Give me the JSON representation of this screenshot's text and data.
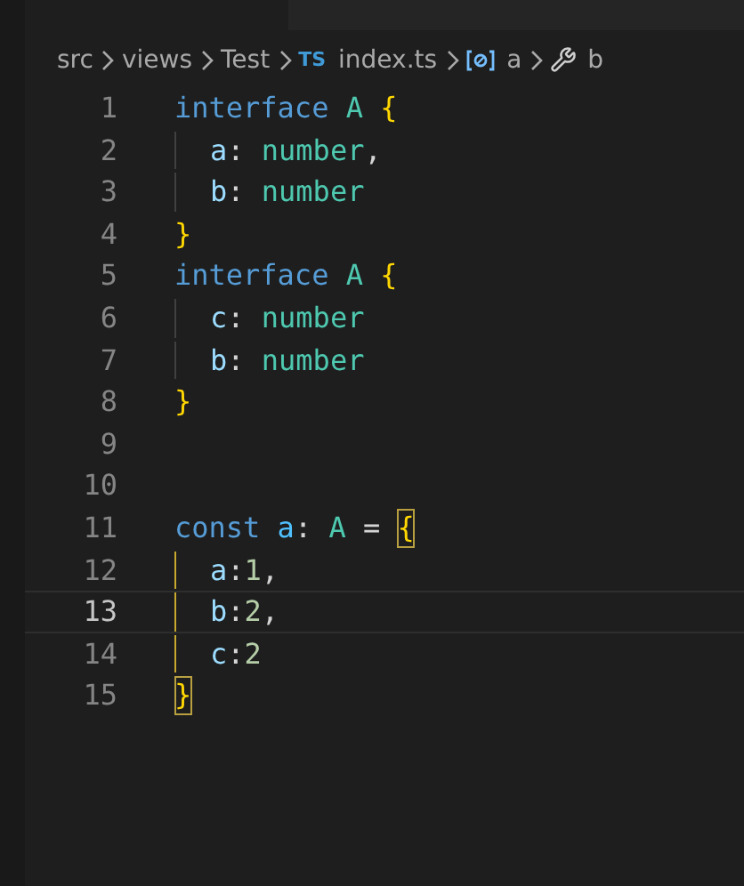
{
  "tab": {
    "selected": true
  },
  "breadcrumbs": [
    {
      "kind": "folder",
      "label": "src"
    },
    {
      "kind": "folder",
      "label": "views"
    },
    {
      "kind": "folder",
      "label": "Test"
    },
    {
      "kind": "file",
      "badge": "TS",
      "label": "index.ts"
    },
    {
      "kind": "variable",
      "label": "a"
    },
    {
      "kind": "property",
      "label": "b"
    }
  ],
  "lines": [
    {
      "number": "1",
      "selected": false,
      "kind": "plain",
      "tokens": [
        {
          "kind": "keyword",
          "text": "interface "
        },
        {
          "kind": "type",
          "text": "A "
        },
        {
          "kind": "bracket",
          "text": "{"
        }
      ]
    },
    {
      "number": "2",
      "selected": false,
      "kind": "nested",
      "tokens": [
        {
          "kind": "property",
          "text": "a"
        },
        {
          "kind": "punct",
          "text": ": "
        },
        {
          "kind": "type",
          "text": "number"
        },
        {
          "kind": "punct",
          "text": ","
        }
      ]
    },
    {
      "number": "3",
      "selected": false,
      "kind": "nested",
      "tokens": [
        {
          "kind": "property",
          "text": "b"
        },
        {
          "kind": "punct",
          "text": ": "
        },
        {
          "kind": "type",
          "text": "number"
        }
      ]
    },
    {
      "number": "4",
      "selected": false,
      "kind": "plain",
      "tokens": [
        {
          "kind": "bracket",
          "text": "}"
        }
      ]
    },
    {
      "number": "5",
      "selected": false,
      "kind": "plain",
      "tokens": [
        {
          "kind": "keyword",
          "text": "interface "
        },
        {
          "kind": "type",
          "text": "A "
        },
        {
          "kind": "bracket",
          "text": "{"
        }
      ]
    },
    {
      "number": "6",
      "selected": false,
      "kind": "nested",
      "tokens": [
        {
          "kind": "property",
          "text": "c"
        },
        {
          "kind": "punct",
          "text": ": "
        },
        {
          "kind": "type",
          "text": "number"
        }
      ]
    },
    {
      "number": "7",
      "selected": false,
      "kind": "nested",
      "tokens": [
        {
          "kind": "property",
          "text": "b"
        },
        {
          "kind": "punct",
          "text": ": "
        },
        {
          "kind": "type",
          "text": "number"
        }
      ]
    },
    {
      "number": "8",
      "selected": false,
      "kind": "plain",
      "tokens": [
        {
          "kind": "bracket",
          "text": "}"
        }
      ]
    },
    {
      "number": "9",
      "selected": false,
      "kind": "plain"
    },
    {
      "number": "10",
      "selected": false,
      "kind": "plain"
    },
    {
      "number": "11",
      "selected": false,
      "kind": "plain",
      "tokens": [
        {
          "kind": "keyword",
          "text": "const "
        },
        {
          "kind": "variable",
          "text": "a"
        },
        {
          "kind": "punct",
          "text": ": "
        },
        {
          "kind": "type",
          "text": "A "
        },
        {
          "kind": "punct",
          "text": "= "
        },
        {
          "kind": "bracket_match",
          "text": "{"
        }
      ]
    },
    {
      "number": "12",
      "selected": false,
      "kind": "bracketed",
      "tokens": [
        {
          "kind": "property",
          "text": "a"
        },
        {
          "kind": "punct",
          "text": ":"
        },
        {
          "kind": "number",
          "text": "1"
        },
        {
          "kind": "punct",
          "text": ","
        }
      ]
    },
    {
      "number": "13",
      "selected": true,
      "kind": "bracketed",
      "tokens": [
        {
          "kind": "property",
          "text": "b"
        },
        {
          "kind": "punct",
          "text": ":"
        },
        {
          "kind": "number",
          "text": "2"
        },
        {
          "kind": "punct",
          "text": ","
        }
      ]
    },
    {
      "number": "14",
      "selected": false,
      "kind": "bracketed",
      "tokens": [
        {
          "kind": "property",
          "text": "c"
        },
        {
          "kind": "punct",
          "text": ":"
        },
        {
          "kind": "number",
          "text": "2"
        }
      ]
    },
    {
      "number": "15",
      "selected": false,
      "kind": "plain",
      "tokens": [
        {
          "kind": "bracket_match",
          "text": "}"
        }
      ]
    }
  ]
}
